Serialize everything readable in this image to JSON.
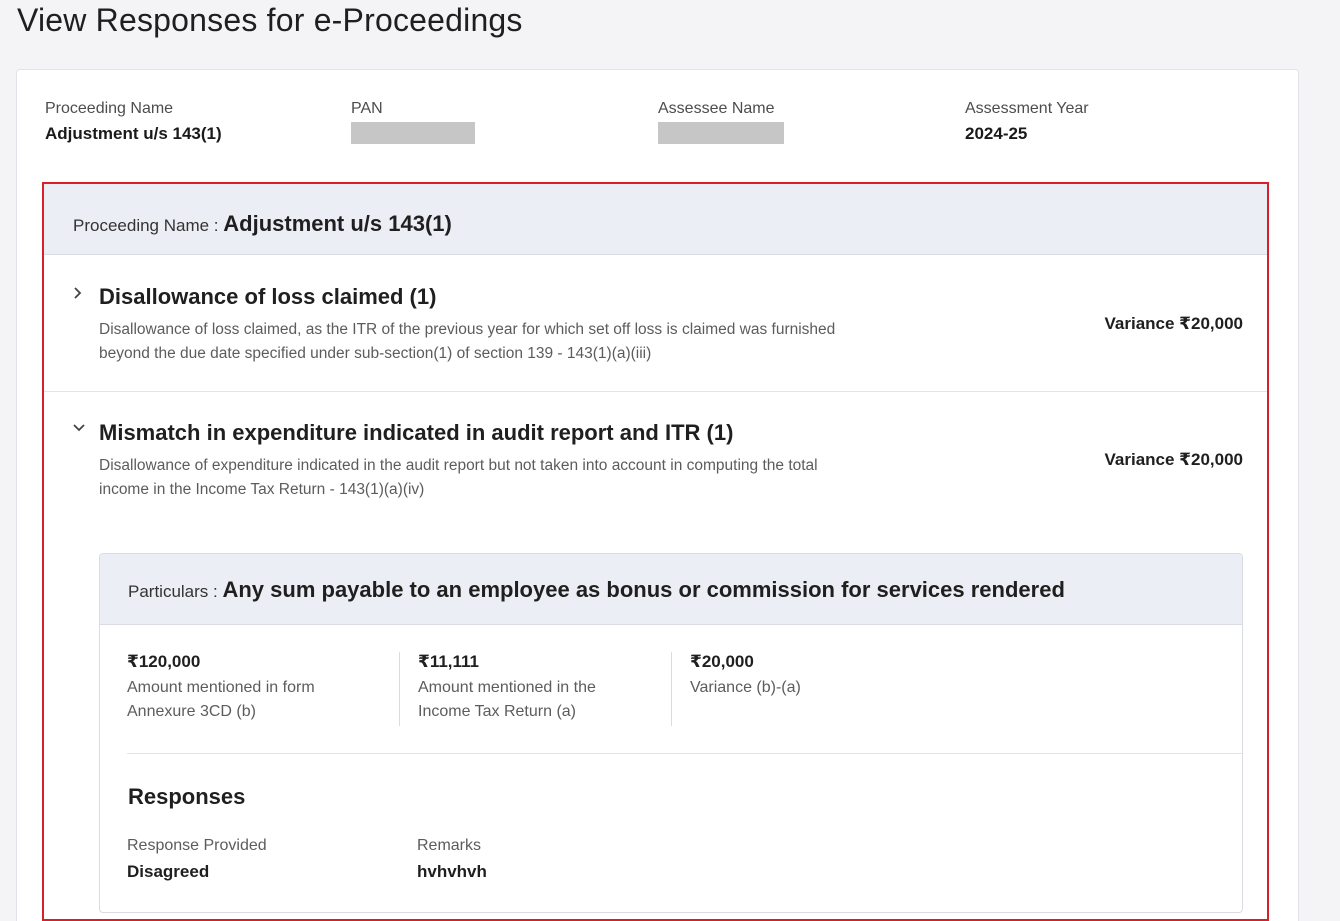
{
  "page": {
    "title": "View Responses for e-Proceedings"
  },
  "summary": {
    "proceeding_name_label": "Proceeding Name",
    "proceeding_name_value": "Adjustment u/s 143(1)",
    "pan_label": "PAN",
    "assessee_name_label": "Assessee Name",
    "assessment_year_label": "Assessment Year",
    "assessment_year_value": "2024-25"
  },
  "proceeding": {
    "label": "Proceeding Name : ",
    "value": "Adjustment u/s 143(1)"
  },
  "adjustments": [
    {
      "title": "Disallowance of loss claimed (1)",
      "description": "Disallowance of loss claimed, as the ITR of the previous year for which set off loss is claimed was furnished beyond the due date specified under sub-section(1) of section 139 - 143(1)(a)(iii)",
      "variance": "Variance ₹20,000",
      "expanded": false
    },
    {
      "title": "Mismatch in expenditure indicated in audit report and ITR (1)",
      "description": "Disallowance of expenditure indicated in the audit report but not taken into account in computing the total income in the Income Tax Return - 143(1)(a)(iv)",
      "variance": "Variance ₹20,000",
      "expanded": true
    }
  ],
  "particulars": {
    "label": "Particulars : ",
    "value": "Any sum payable to an employee as bonus or commission for services rendered",
    "amounts": [
      {
        "value": "₹120,000",
        "label": "Amount mentioned in form Annexure 3CD (b)"
      },
      {
        "value": "₹11,111",
        "label": "Amount mentioned in the Income Tax Return (a)"
      },
      {
        "value": "₹20,000",
        "label": "Variance (b)-(a)"
      }
    ],
    "responses_title": "Responses",
    "response_provided_label": "Response Provided",
    "response_provided_value": "Disagreed",
    "remarks_label": "Remarks",
    "remarks_value": "hvhvhvh"
  },
  "colors": {
    "highlight_border": "#d8202a",
    "header_bg": "#eceef5"
  },
  "icons": {
    "collapsed": "chevron-right-icon",
    "expanded": "chevron-down-icon"
  }
}
